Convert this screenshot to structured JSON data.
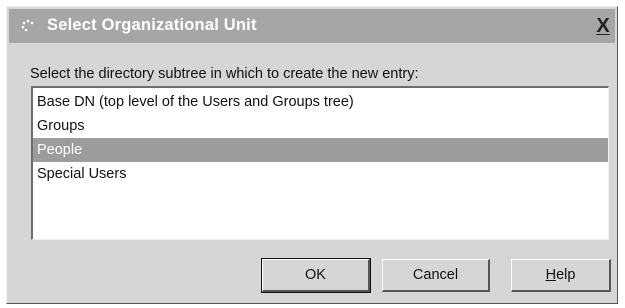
{
  "window": {
    "title": "Select Organizational Unit",
    "close_label": "X",
    "icon": "app-icon"
  },
  "prompt": "Select the directory subtree in which to create the new entry:",
  "list": {
    "items": [
      {
        "label": "Base DN (top level of the Users and Groups tree)",
        "selected": false
      },
      {
        "label": "Groups",
        "selected": false
      },
      {
        "label": "People",
        "selected": true
      },
      {
        "label": "Special Users",
        "selected": false
      }
    ]
  },
  "buttons": {
    "ok": "OK",
    "cancel": "Cancel",
    "help_mnemonic": "H",
    "help_rest": "elp"
  },
  "colors": {
    "title_bar": "#a6a6a6",
    "dialog_face": "#d6d6d6",
    "selection": "#9c9c9c"
  }
}
